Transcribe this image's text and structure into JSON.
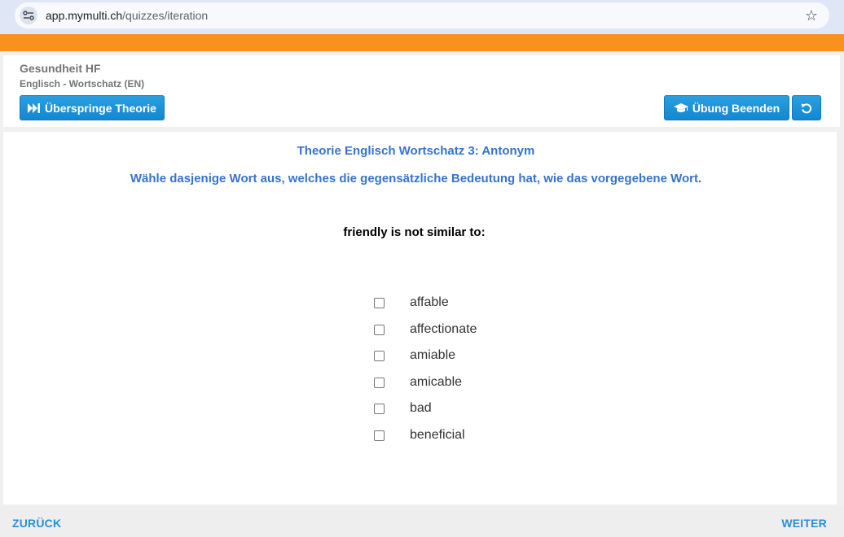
{
  "browser": {
    "url_host": "app.mymulti.ch",
    "url_path": "/quizzes/iteration",
    "site_info_icon": "tune-icon",
    "bookmark_icon": "star-icon"
  },
  "colors": {
    "accent_orange": "#f7921e",
    "button_blue": "#1a8fd6",
    "heading_blue": "#3673cf"
  },
  "header": {
    "course_title": "Gesundheit HF",
    "course_subtitle": "Englisch - Wortschatz (EN)",
    "skip_theory_label": "Überspringe Theorie",
    "skip_theory_icon": "fast-forward-icon",
    "end_exercise_label": "Übung Beenden",
    "end_exercise_icon": "graduation-cap-icon",
    "reset_icon": "undo-icon"
  },
  "main": {
    "theory_title": "Theorie Englisch Wortschatz 3: Antonym",
    "instruction": "Wähle dasjenige Wort aus, welches die gegensätzliche Bedeutung hat, wie das vorgegebene Wort.",
    "question": "friendly is not similar to:",
    "options": [
      {
        "label": "affable",
        "checked": false
      },
      {
        "label": "affectionate",
        "checked": false
      },
      {
        "label": "amiable",
        "checked": false
      },
      {
        "label": "amicable",
        "checked": false
      },
      {
        "label": "bad",
        "checked": false
      },
      {
        "label": "beneficial",
        "checked": false
      }
    ]
  },
  "footer": {
    "back_label": "ZURÜCK",
    "next_label": "WEITER"
  }
}
